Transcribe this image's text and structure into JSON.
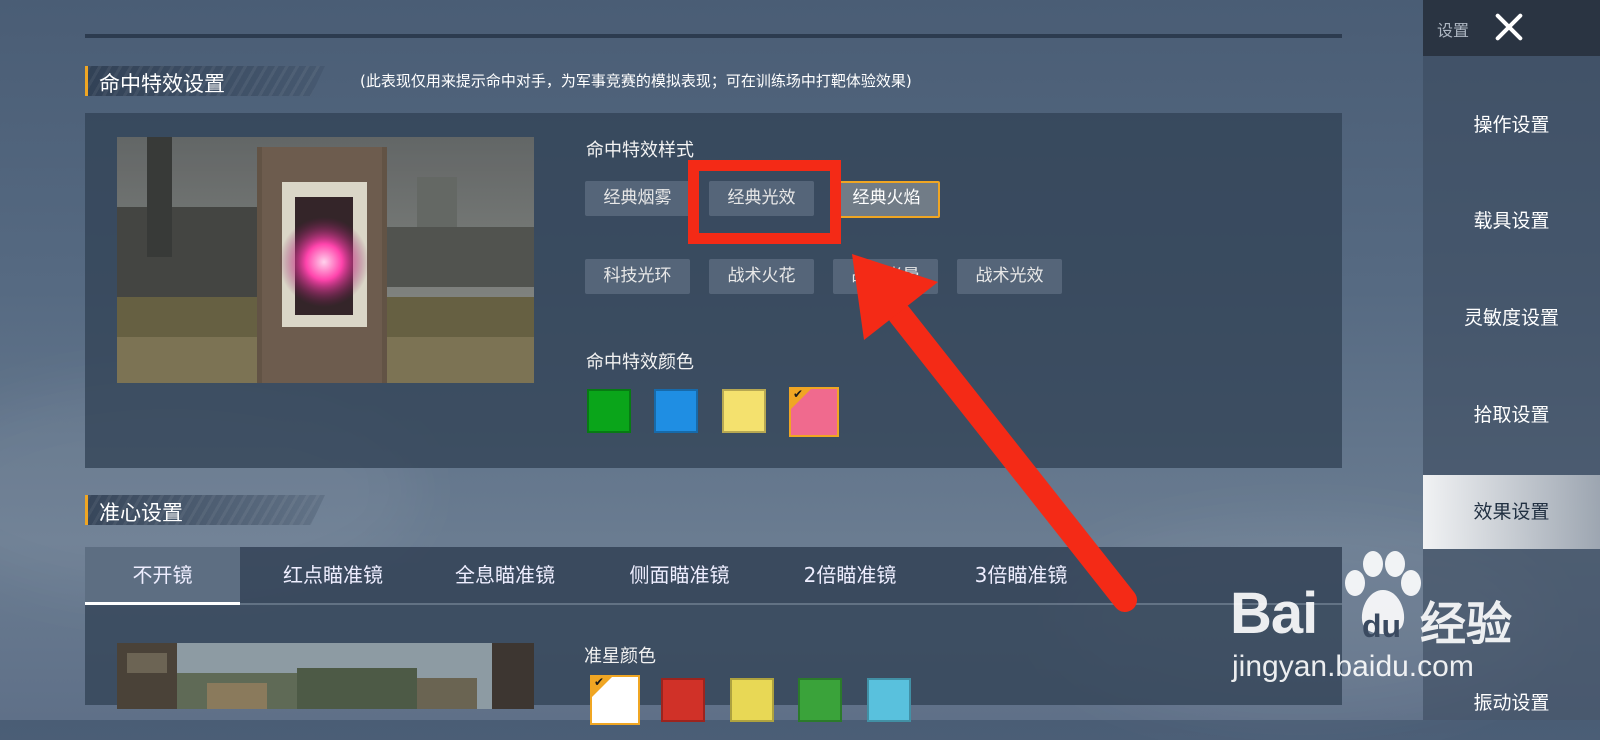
{
  "hit_effect": {
    "section_title": "命中特效设置",
    "note": "(此表现仅用来提示命中对手，为军事竞赛的模拟表现；可在训练场中打靶体验效果)",
    "style_label": "命中特效样式",
    "styles": [
      "经典烟雾",
      "经典光效",
      "经典火焰",
      "科技光环",
      "战术火花",
      "战术光晕",
      "战术光效"
    ],
    "selected_style": "经典火焰",
    "color_label": "命中特效颜色",
    "colors": [
      "#0aa51a",
      "#1f8ee3",
      "#f4e16e",
      "#f06a8e"
    ],
    "selected_color_index": 3
  },
  "crosshair": {
    "section_title": "准心设置",
    "tabs": [
      "不开镜",
      "红点瞄准镜",
      "全息瞄准镜",
      "侧面瞄准镜",
      "2倍瞄准镜",
      "3倍瞄准镜"
    ],
    "active_tab": "不开镜",
    "color_label": "准星颜色",
    "colors": [
      "#ffffff",
      "#d03128",
      "#e8d855",
      "#3aa33a",
      "#59c1dd"
    ],
    "selected_color_index": 0
  },
  "sidebar": {
    "title": "设置",
    "items": [
      "操作设置",
      "载具设置",
      "灵敏度设置",
      "拾取设置",
      "效果设置",
      "",
      "振动设置"
    ],
    "active_item": "效果设置"
  },
  "watermark": {
    "brand": "Bai",
    "brand_suffix": "du",
    "product": "经验",
    "url": "jingyan.baidu.com"
  }
}
